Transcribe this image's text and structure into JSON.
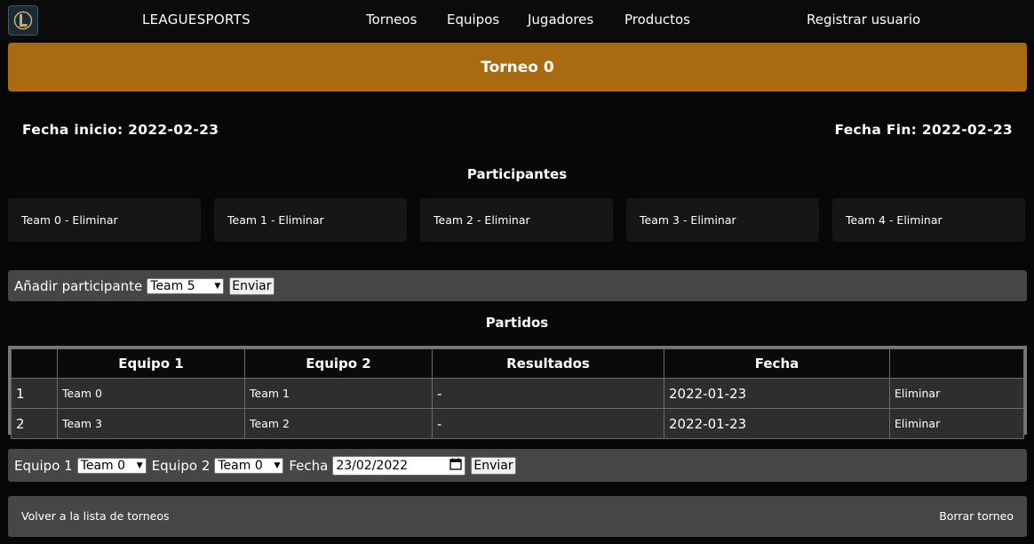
{
  "nav": {
    "brand": "LEAGUESPORTS",
    "links": [
      "Torneos",
      "Equipos",
      "Jugadores",
      "Productos"
    ],
    "register": "Registrar usuario"
  },
  "header": {
    "title": "Torneo 0"
  },
  "dates": {
    "start": "Fecha inicio: 2022-02-23",
    "end": "Fecha Fin: 2022-02-23"
  },
  "participants": {
    "title": "Participantes",
    "items": [
      "Team 0 - Eliminar",
      "Team 1 - Eliminar",
      "Team 2 - Eliminar",
      "Team 3 - Eliminar",
      "Team 4 - Eliminar"
    ]
  },
  "add_participant": {
    "label": "Añadir participante",
    "selected": "Team 5",
    "submit": "Enviar"
  },
  "matches": {
    "title": "Partidos",
    "headers": [
      "",
      "Equipo 1",
      "Equipo 2",
      "Resultados",
      "Fecha",
      ""
    ],
    "rows": [
      {
        "num": "1",
        "team1": "Team 0",
        "team2": "Team 1",
        "result": "-",
        "date": "2022-01-23",
        "action": "Eliminar"
      },
      {
        "num": "2",
        "team1": "Team 3",
        "team2": "Team 2",
        "result": "-",
        "date": "2022-01-23",
        "action": "Eliminar"
      }
    ]
  },
  "add_match": {
    "team1_label": "Equipo 1",
    "team1_selected": "Team 0",
    "team2_label": "Equipo 2",
    "team2_selected": "Team 0",
    "date_label": "Fecha",
    "date_value": "23/02/2022",
    "submit": "Enviar"
  },
  "footer": {
    "back": "Volver a la lista de torneos",
    "delete": "Borrar torneo"
  },
  "colors": {
    "header_bg": "#a86b12",
    "page_bg": "#070707",
    "bar_bg": "#464646"
  }
}
